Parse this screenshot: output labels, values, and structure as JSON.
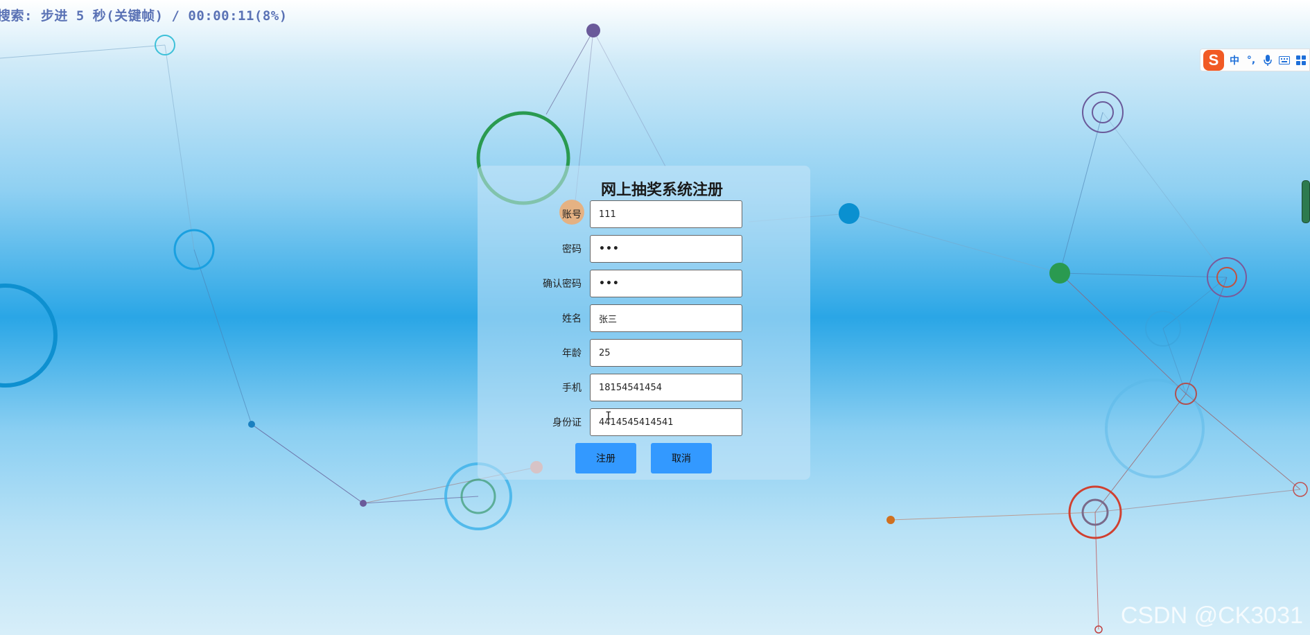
{
  "status_bar": {
    "text": "搜索: 步进 5 秒(关键帧) / 00:00:11(8%)"
  },
  "ime_toolbar": {
    "logo": "S",
    "mode": "中",
    "punct": "°,",
    "mic_icon": "microphone-icon",
    "keyboard_icon": "keyboard-icon",
    "grid_icon": "grid-icon"
  },
  "form": {
    "title": "网上抽奖系统注册",
    "fields": [
      {
        "label": "账号",
        "value": "111",
        "type": "text"
      },
      {
        "label": "密码",
        "value": "•••",
        "type": "password"
      },
      {
        "label": "确认密码",
        "value": "•••",
        "type": "password"
      },
      {
        "label": "姓名",
        "value": "张三",
        "type": "text"
      },
      {
        "label": "年龄",
        "value": "25",
        "type": "text"
      },
      {
        "label": "手机",
        "value": "18154541454",
        "type": "text"
      },
      {
        "label": "身份证",
        "value": "4414545414541",
        "type": "text"
      }
    ],
    "register_button": "注册",
    "cancel_button": "取消"
  },
  "watermark": "CSDN @CK3031",
  "colors": {
    "button_bg": "#3399ff",
    "ime_logo": "#f15a24",
    "panel_bg": "rgba(200,230,248,0.55)"
  }
}
